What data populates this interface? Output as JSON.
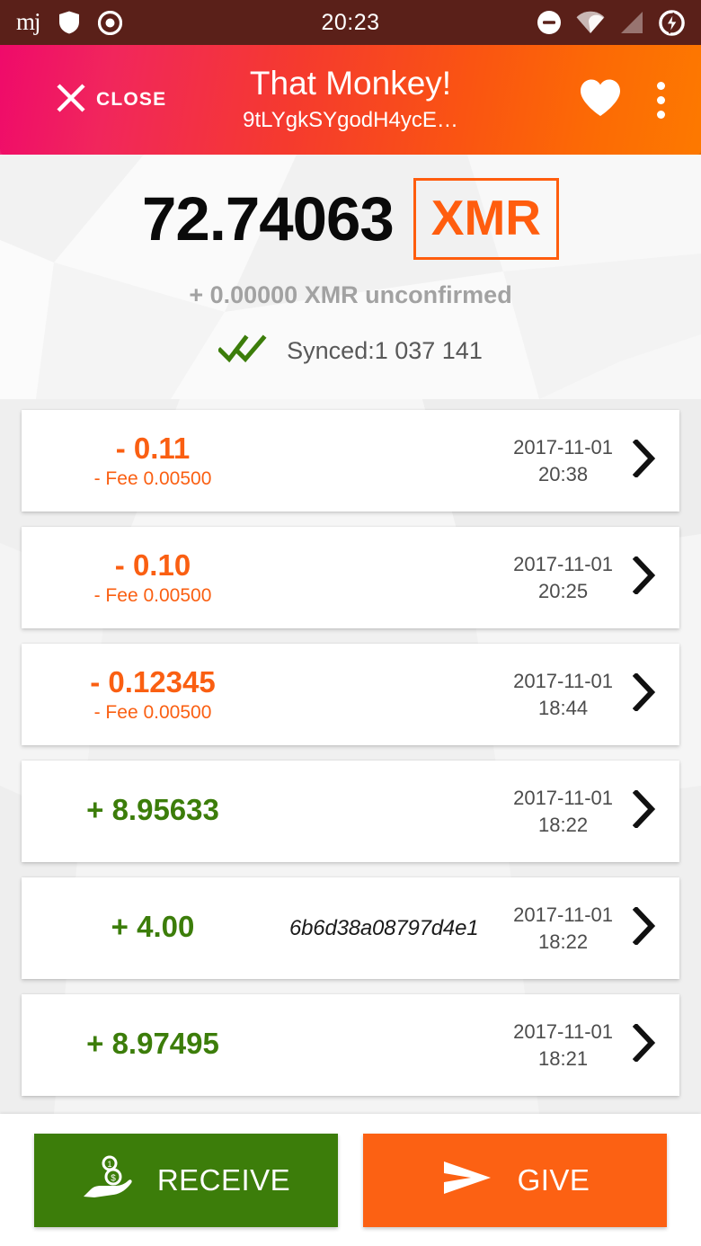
{
  "statusbar": {
    "clock": "20:23",
    "app_logo_text": "mj",
    "left_icons": [
      "monerujo-logo",
      "shield-icon",
      "record-circle-icon"
    ],
    "right_icons": [
      "do-not-disturb-icon",
      "wifi-icon",
      "cellular-signal-icon",
      "battery-charging-icon"
    ],
    "background_color": "#5a2019"
  },
  "toolbar": {
    "close_label": "CLOSE",
    "title": "That Monkey!",
    "subtitle": "9tLYgkSYgodH4ycE…",
    "favorite_icon": "heart-icon",
    "overflow_icon": "overflow-menu-icon",
    "gradient_from": "#ef0a6a",
    "gradient_to": "#fd7900"
  },
  "balance": {
    "amount": "72.74063",
    "currency": "XMR",
    "unconfirmed": "+ 0.00000 XMR unconfirmed",
    "sync_status": "Synced:1 037 141",
    "sync_icon": "double-check-icon",
    "accent_color": "#ff5d0e",
    "sync_icon_color": "#3c7d0a"
  },
  "transactions": [
    {
      "amount": "- 0.11",
      "direction": "out",
      "fee": "- Fee 0.00500",
      "payment_id": "",
      "date": "2017-11-01",
      "time": "20:38"
    },
    {
      "amount": "- 0.10",
      "direction": "out",
      "fee": "- Fee 0.00500",
      "payment_id": "",
      "date": "2017-11-01",
      "time": "20:25"
    },
    {
      "amount": "- 0.12345",
      "direction": "out",
      "fee": "- Fee 0.00500",
      "payment_id": "",
      "date": "2017-11-01",
      "time": "18:44"
    },
    {
      "amount": "+ 8.95633",
      "direction": "in",
      "fee": "",
      "payment_id": "",
      "date": "2017-11-01",
      "time": "18:22"
    },
    {
      "amount": "+ 4.00",
      "direction": "in",
      "fee": "",
      "payment_id": "6b6d38a08797d4e1",
      "date": "2017-11-01",
      "time": "18:22"
    },
    {
      "amount": "+ 8.97495",
      "direction": "in",
      "fee": "",
      "payment_id": "",
      "date": "2017-11-01",
      "time": "18:21"
    }
  ],
  "bottom_bar": {
    "receive_label": "RECEIVE",
    "receive_icon": "hand-coins-icon",
    "receive_color": "#3c7d0a",
    "give_label": "GIVE",
    "give_icon": "send-arrow-icon",
    "give_color": "#fc6113"
  }
}
